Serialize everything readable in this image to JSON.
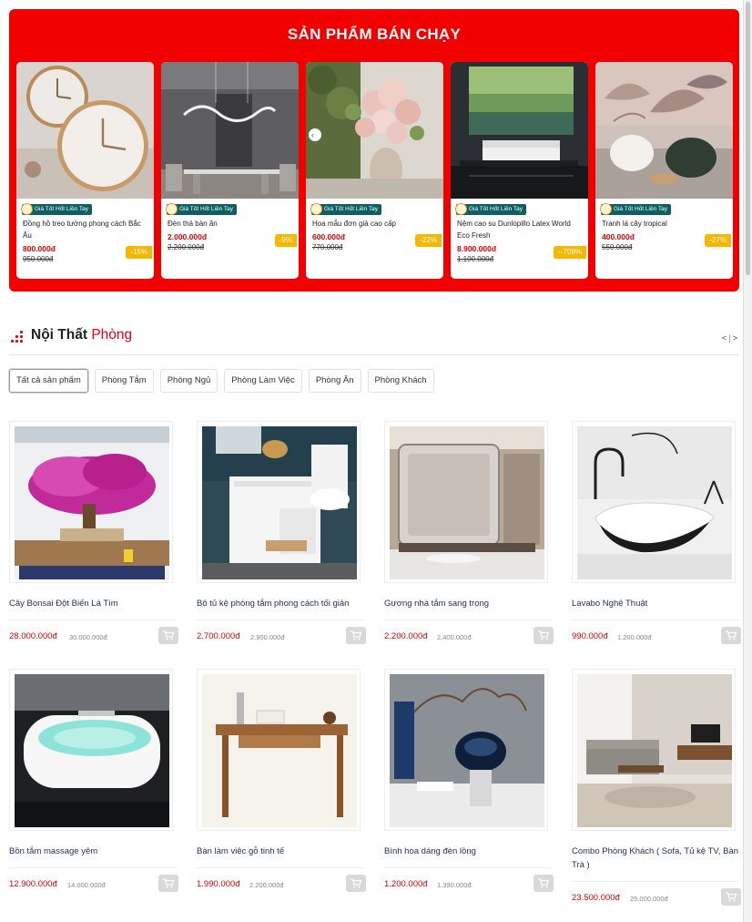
{
  "bestseller": {
    "title": "SẢN PHẨM BÁN CHẠY",
    "badge_icon": "deal-tag-icon",
    "items": [
      {
        "badge": "Giá Tốt Hốt Liền Tay",
        "name": "Đồng hồ treo tường phong cách Bắc Âu",
        "price": "800.000đ",
        "old_price": "950.000đ",
        "discount": "-15%"
      },
      {
        "badge": "Giá Tốt Hốt Liền Tay",
        "name": "Đèn thả bàn ăn",
        "price": "2.000.000đ",
        "old_price": "2.200.000đ",
        "discount": "-9%"
      },
      {
        "badge": "Giá Tốt Hốt Liền Tay",
        "name": "Hoa mẫu đơn giả cao cấp",
        "price": "600.000đ",
        "old_price": "770.000đ",
        "discount": "-22%"
      },
      {
        "badge": "Giá Tốt Hốt Liền Tay",
        "name": "Nệm cao su Dunlopillo Latex World Eco Fresh",
        "price": "8.900.000đ",
        "old_price": "1.100.000đ",
        "discount": "--709%"
      },
      {
        "badge": "Giá Tốt Hốt Liền Tay",
        "name": "Tranh lá cây tropical",
        "price": "400.000đ",
        "old_price": "550.000đ",
        "discount": "-27%"
      }
    ]
  },
  "room_section": {
    "title_main": "Nội Thất",
    "title_highlight": "Phòng",
    "nav_prev": "<",
    "nav_sep": "|",
    "nav_next": ">",
    "tabs": [
      "Tất cả sản phẩm",
      "Phòng Tắm",
      "Phòng Ngủ",
      "Phòng Làm Việc",
      "Phòng Ăn",
      "Phòng Khách"
    ],
    "active_tab": "Tất cả sản phẩm",
    "products": [
      {
        "name": "Cây Bonsai Đột Biến Lá Tím",
        "price": "28.000.000đ",
        "old_price": "30.000.000đ"
      },
      {
        "name": "Bộ tủ kệ phòng tắm phong cách tối giản",
        "price": "2.700.000đ",
        "old_price": "2.900.000đ"
      },
      {
        "name": "Gương nhà tắm sang trọng",
        "price": "2.200.000đ",
        "old_price": "2.400.000đ"
      },
      {
        "name": "Lavabo Nghệ Thuật",
        "price": "990.000đ",
        "old_price": "1.200.000đ"
      },
      {
        "name": "Bồn tắm massage yêm",
        "price": "12.900.000đ",
        "old_price": "14.000.000đ"
      },
      {
        "name": "Bàn làm việc gỗ tinh tế",
        "price": "1.990.000đ",
        "old_price": "2.200.000đ"
      },
      {
        "name": "Bình hoa dáng đèn lồng",
        "price": "1.200.000đ",
        "old_price": "1.390.000đ"
      },
      {
        "name": "Combo Phòng Khách ( Sofa, Tủ kệ TV, Bàn Trà )",
        "price": "23.500.000đ",
        "old_price": "25.000.000đ"
      }
    ],
    "cart_icon": "cart-icon"
  },
  "colors": {
    "accent": "#f20000",
    "badge": "#0e5e63",
    "discount": "#f5b700",
    "price": "#e20000",
    "product_name": "#1f2d5a"
  }
}
